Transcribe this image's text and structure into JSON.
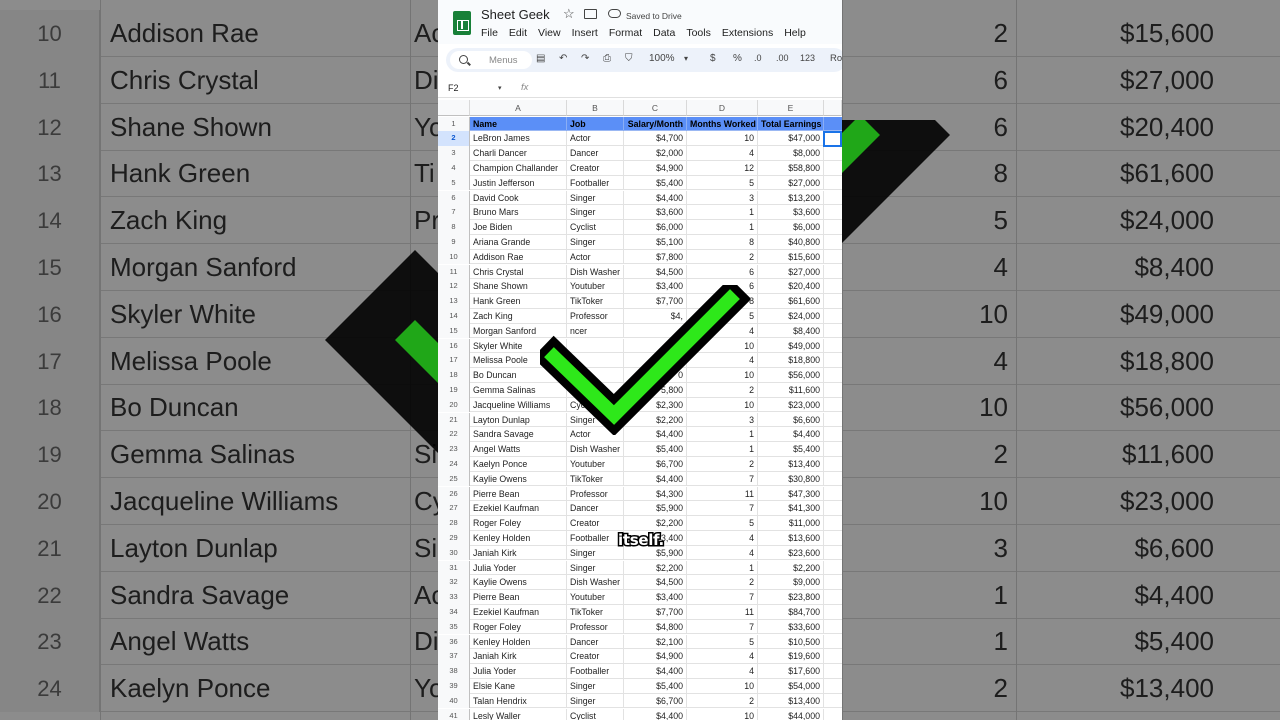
{
  "app": {
    "title": "Sheet Geek",
    "saved_status": "Saved to Drive",
    "menu": [
      "File",
      "Edit",
      "View",
      "Insert",
      "Format",
      "Data",
      "Tools",
      "Extensions",
      "Help"
    ],
    "search_placeholder": "Menus",
    "zoom": "100%",
    "currency_symbol": "$",
    "percent_symbol": "%",
    "decrease_decimal": ".0",
    "increase_decimal": ".00",
    "number_format": "123",
    "font_partial": "Ro",
    "name_box": "F2",
    "fx": "fx"
  },
  "columns": [
    "A",
    "B",
    "C",
    "D",
    "E"
  ],
  "header": {
    "row_num": "1",
    "cells": [
      "Name",
      "Job",
      "Salary/Month",
      "Months Worked",
      "Total Earnings"
    ]
  },
  "rows": [
    {
      "n": "2",
      "cells": [
        "LeBron James",
        "Actor",
        "$4,700",
        "10",
        "$47,000"
      ]
    },
    {
      "n": "3",
      "cells": [
        "Charli Dancer",
        "Dancer",
        "$2,000",
        "4",
        "$8,000"
      ]
    },
    {
      "n": "4",
      "cells": [
        "Champion Challander",
        "Creator",
        "$4,900",
        "12",
        "$58,800"
      ]
    },
    {
      "n": "5",
      "cells": [
        "Justin Jefferson",
        "Footballer",
        "$5,400",
        "5",
        "$27,000"
      ]
    },
    {
      "n": "6",
      "cells": [
        "David Cook",
        "Singer",
        "$4,400",
        "3",
        "$13,200"
      ]
    },
    {
      "n": "7",
      "cells": [
        "Bruno Mars",
        "Singer",
        "$3,600",
        "1",
        "$3,600"
      ]
    },
    {
      "n": "8",
      "cells": [
        "Joe Biden",
        "Cyclist",
        "$6,000",
        "1",
        "$6,000"
      ]
    },
    {
      "n": "9",
      "cells": [
        "Ariana Grande",
        "Singer",
        "$5,100",
        "8",
        "$40,800"
      ]
    },
    {
      "n": "10",
      "cells": [
        "Addison Rae",
        "Actor",
        "$7,800",
        "2",
        "$15,600"
      ]
    },
    {
      "n": "11",
      "cells": [
        "Chris Crystal",
        "Dish Washer",
        "$4,500",
        "6",
        "$27,000"
      ]
    },
    {
      "n": "12",
      "cells": [
        "Shane Shown",
        "Youtuber",
        "$3,400",
        "6",
        "$20,400"
      ]
    },
    {
      "n": "13",
      "cells": [
        "Hank Green",
        "TikToker",
        "$7,700",
        "8",
        "$61,600"
      ]
    },
    {
      "n": "14",
      "cells": [
        "Zach King",
        "Professor",
        "$4,",
        "5",
        "$24,000"
      ]
    },
    {
      "n": "15",
      "cells": [
        "Morgan Sanford",
        "ncer",
        "",
        "4",
        "$8,400"
      ]
    },
    {
      "n": "16",
      "cells": [
        "Skyler White",
        "",
        "",
        "10",
        "$49,000"
      ]
    },
    {
      "n": "17",
      "cells": [
        "Melissa Poole",
        "",
        "",
        "4",
        "$18,800"
      ]
    },
    {
      "n": "18",
      "cells": [
        "Bo Duncan",
        "",
        "0",
        "10",
        "$56,000"
      ]
    },
    {
      "n": "19",
      "cells": [
        "Gemma Salinas",
        "S",
        "5,800",
        "2",
        "$11,600"
      ]
    },
    {
      "n": "20",
      "cells": [
        "Jacqueline Williams",
        "Cycl",
        "$2,300",
        "10",
        "$23,000"
      ]
    },
    {
      "n": "21",
      "cells": [
        "Layton Dunlap",
        "Singer",
        "$2,200",
        "3",
        "$6,600"
      ]
    },
    {
      "n": "22",
      "cells": [
        "Sandra Savage",
        "Actor",
        "$4,400",
        "1",
        "$4,400"
      ]
    },
    {
      "n": "23",
      "cells": [
        "Angel Watts",
        "Dish Washer",
        "$5,400",
        "1",
        "$5,400"
      ]
    },
    {
      "n": "24",
      "cells": [
        "Kaelyn Ponce",
        "Youtuber",
        "$6,700",
        "2",
        "$13,400"
      ]
    },
    {
      "n": "25",
      "cells": [
        "Kaylie Owens",
        "TikToker",
        "$4,400",
        "7",
        "$30,800"
      ]
    },
    {
      "n": "26",
      "cells": [
        "Pierre Bean",
        "Professor",
        "$4,300",
        "11",
        "$47,300"
      ]
    },
    {
      "n": "27",
      "cells": [
        "Ezekiel Kaufman",
        "Dancer",
        "$5,900",
        "7",
        "$41,300"
      ]
    },
    {
      "n": "28",
      "cells": [
        "Roger Foley",
        "Creator",
        "$2,200",
        "5",
        "$11,000"
      ]
    },
    {
      "n": "29",
      "cells": [
        "Kenley Holden",
        "Footballer",
        "3,400",
        "4",
        "$13,600"
      ]
    },
    {
      "n": "30",
      "cells": [
        "Janiah Kirk",
        "Singer",
        "$5,900",
        "4",
        "$23,600"
      ]
    },
    {
      "n": "31",
      "cells": [
        "Julia Yoder",
        "Singer",
        "$2,200",
        "1",
        "$2,200"
      ]
    },
    {
      "n": "32",
      "cells": [
        "Kaylie Owens",
        "Dish Washer",
        "$4,500",
        "2",
        "$9,000"
      ]
    },
    {
      "n": "33",
      "cells": [
        "Pierre Bean",
        "Youtuber",
        "$3,400",
        "7",
        "$23,800"
      ]
    },
    {
      "n": "34",
      "cells": [
        "Ezekiel Kaufman",
        "TikToker",
        "$7,700",
        "11",
        "$84,700"
      ]
    },
    {
      "n": "35",
      "cells": [
        "Roger Foley",
        "Professor",
        "$4,800",
        "7",
        "$33,600"
      ]
    },
    {
      "n": "36",
      "cells": [
        "Kenley Holden",
        "Dancer",
        "$2,100",
        "5",
        "$10,500"
      ]
    },
    {
      "n": "37",
      "cells": [
        "Janiah Kirk",
        "Creator",
        "$4,900",
        "4",
        "$19,600"
      ]
    },
    {
      "n": "38",
      "cells": [
        "Julia Yoder",
        "Footballer",
        "$4,400",
        "4",
        "$17,600"
      ]
    },
    {
      "n": "39",
      "cells": [
        "Elsie Kane",
        "Singer",
        "$5,400",
        "10",
        "$54,000"
      ]
    },
    {
      "n": "40",
      "cells": [
        "Talan Hendrix",
        "Singer",
        "$6,700",
        "2",
        "$13,400"
      ]
    },
    {
      "n": "41",
      "cells": [
        "Lesly Waller",
        "Cyclist",
        "$4,400",
        "10",
        "$44,000"
      ]
    }
  ],
  "background": {
    "rows": [
      {
        "n": "10",
        "name": "Addison Rae",
        "job": "Ac",
        "months": "2",
        "total": "$15,600"
      },
      {
        "n": "11",
        "name": "Chris Crystal",
        "job": "Di",
        "months": "6",
        "total": "$27,000"
      },
      {
        "n": "12",
        "name": "Shane Shown",
        "job": "Yo",
        "months": "6",
        "total": "$20,400"
      },
      {
        "n": "13",
        "name": "Hank Green",
        "job": "Ti",
        "months": "8",
        "total": "$61,600"
      },
      {
        "n": "14",
        "name": "Zach King",
        "job": "Pr",
        "months": "5",
        "total": "$24,000"
      },
      {
        "n": "15",
        "name": "Morgan Sanford",
        "job": "",
        "months": "4",
        "total": "$8,400"
      },
      {
        "n": "16",
        "name": "Skyler White",
        "job": "",
        "months": "10",
        "total": "$49,000"
      },
      {
        "n": "17",
        "name": "Melissa Poole",
        "job": "",
        "months": "4",
        "total": "$18,800"
      },
      {
        "n": "18",
        "name": "Bo Duncan",
        "job": "",
        "months": "10",
        "total": "$56,000"
      },
      {
        "n": "19",
        "name": "Gemma Salinas",
        "job": "Si",
        "months": "2",
        "total": "$11,600"
      },
      {
        "n": "20",
        "name": "Jacqueline Williams",
        "job": "Cy",
        "months": "10",
        "total": "$23,000"
      },
      {
        "n": "21",
        "name": "Layton Dunlap",
        "job": "Si",
        "months": "3",
        "total": "$6,600"
      },
      {
        "n": "22",
        "name": "Sandra Savage",
        "job": "Ac",
        "months": "1",
        "total": "$4,400"
      },
      {
        "n": "23",
        "name": "Angel Watts",
        "job": "Di",
        "months": "1",
        "total": "$5,400"
      },
      {
        "n": "24",
        "name": "Kaelyn Ponce",
        "job": "Yo",
        "months": "2",
        "total": "$13,400"
      }
    ]
  },
  "caption": "itself.",
  "colors": {
    "header_fill": "#5b8ff7",
    "check_green": "#2ee81a",
    "check_outline": "#000000",
    "sheets_green": "#188038",
    "selection_blue": "#1a73e8"
  }
}
